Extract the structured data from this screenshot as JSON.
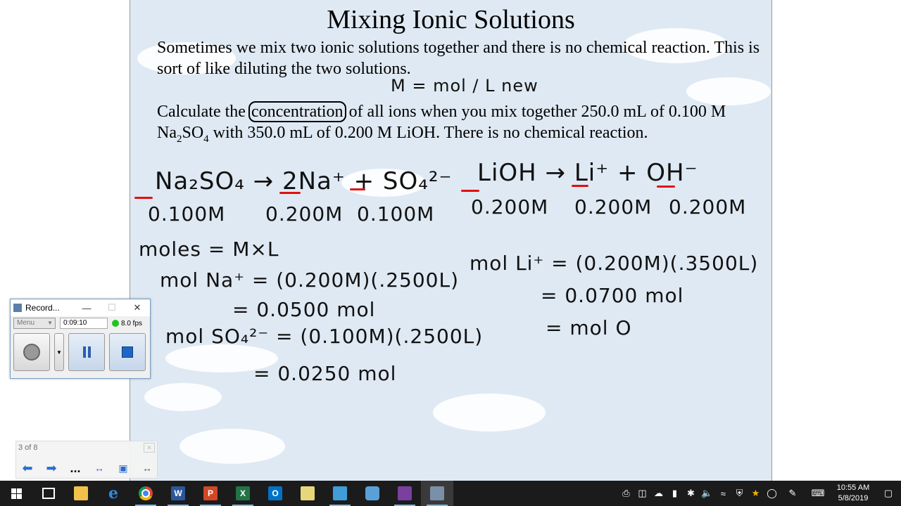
{
  "slide": {
    "title": "Mixing Ionic Solutions",
    "para1": "Sometimes we mix two ionic solutions together and there is no chemical reaction. This is sort of like diluting the two solutions.",
    "para2_a": "Calculate the ",
    "para2_highlight": "concentration",
    "para2_b": " of all ions when you mix together 250.0 mL of 0.100 M Na",
    "para2_sub1": "2",
    "para2_c": "SO",
    "para2_sub2": "4",
    "para2_d": " with 350.0 mL of 0.200 M LiOH. There is no chemical reaction."
  },
  "handwriting": {
    "formula_top": "M = mol / L new",
    "eq1": "Na₂SO₄ → 2Na⁺ + SO₄²⁻",
    "eq1_conc": [
      "0.100M",
      "0.200M",
      "0.100M"
    ],
    "eq2": "LiOH → Li⁺ + OH⁻",
    "eq2_conc": [
      "0.200M",
      "0.200M",
      "0.200M"
    ],
    "moles": "moles = M×L",
    "na_calc": "mol Na⁺ = (0.200M)(.2500L)",
    "na_result": "= 0.0500 mol",
    "so4_calc": "mol SO₄²⁻ = (0.100M)(.2500L)",
    "so4_result": "= 0.0250 mol",
    "li_calc": "mol Li⁺ = (0.200M)(.3500L)",
    "li_result": "= 0.0700 mol",
    "oh_partial": "= mol O"
  },
  "recorder": {
    "title": "Record...",
    "menu": "Menu",
    "time": "0:09:10",
    "fps": "8.0 fps"
  },
  "slidenav": {
    "count": "3 of 8",
    "ellipsis": "..."
  },
  "taskbar": {
    "time": "10:55 AM",
    "date": "5/8/2019"
  },
  "colors": {
    "accent_red": "#e01010",
    "slide_bg": "#dfe9f3",
    "taskbar_bg": "#1b1b1b"
  }
}
